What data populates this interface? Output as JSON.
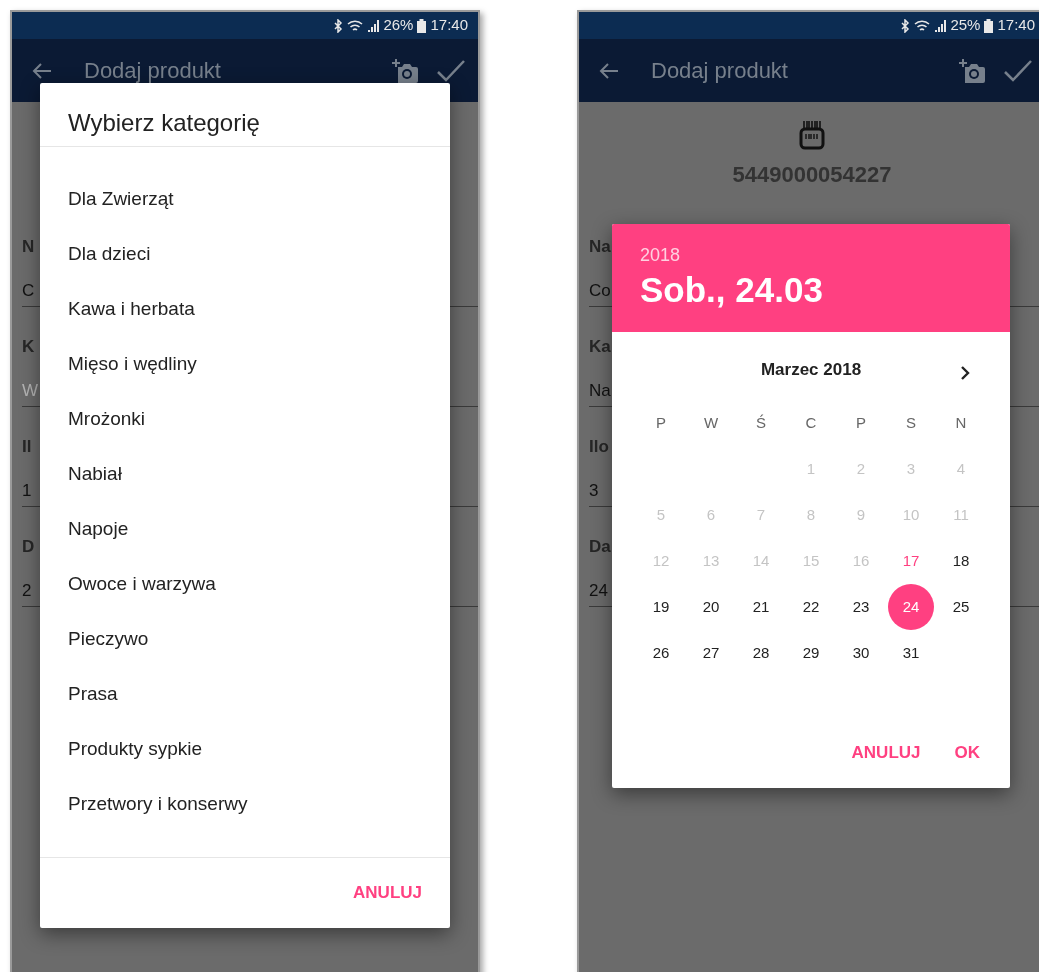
{
  "phones": [
    {
      "status_bar": {
        "battery": "26%",
        "time": "17:40"
      },
      "app_bar": {
        "title": "Dodaj produkt"
      },
      "fields": [
        {
          "label": "N",
          "value": "C"
        },
        {
          "label": "K",
          "placeholder": "W"
        },
        {
          "label": "Il",
          "value": "1"
        },
        {
          "label": "D",
          "value": "2"
        }
      ],
      "dialog": {
        "kind": "category_list",
        "title": "Wybierz kategorię",
        "items": [
          "Dla Zwierząt",
          "Dla dzieci",
          "Kawa i herbata",
          "Mięso i wędliny",
          "Mrożonki",
          "Nabiał",
          "Napoje",
          "Owoce i warzywa",
          "Pieczywo",
          "Prasa",
          "Produkty sypkie",
          "Przetwory i konserwy"
        ],
        "buttons": [
          "ANULUJ"
        ]
      }
    },
    {
      "status_bar": {
        "battery": "25%",
        "time": "17:40"
      },
      "app_bar": {
        "title": "Dodaj produkt"
      },
      "barcode": "5449000054227",
      "fields": [
        {
          "label": "Na",
          "value": "Co"
        },
        {
          "label": "Ka",
          "value": "Na"
        },
        {
          "label": "Ilo",
          "value": "3"
        },
        {
          "label": "Da",
          "value": "24"
        }
      ],
      "dialog": {
        "kind": "date_picker",
        "year": "2018",
        "date": "Sob., 24.03",
        "month": "Marzec 2018",
        "weekdays": [
          "P",
          "W",
          "Ś",
          "C",
          "P",
          "S",
          "N"
        ],
        "weeks": [
          [
            {
              "day": "1",
              "disabled": true,
              "today": false,
              "selected": false
            },
            {
              "day": "2",
              "disabled": true,
              "today": false,
              "selected": false
            },
            {
              "day": "3",
              "disabled": true,
              "today": false,
              "selected": false
            },
            {
              "day": "4",
              "disabled": true,
              "today": false,
              "selected": false
            }
          ],
          [
            {
              "day": "5",
              "disabled": true,
              "today": false,
              "selected": false
            },
            {
              "day": "6",
              "disabled": true,
              "today": false,
              "selected": false
            },
            {
              "day": "7",
              "disabled": true,
              "today": false,
              "selected": false
            },
            {
              "day": "8",
              "disabled": true,
              "today": false,
              "selected": false
            },
            {
              "day": "9",
              "disabled": true,
              "today": false,
              "selected": false
            },
            {
              "day": "10",
              "disabled": true,
              "today": false,
              "selected": false
            },
            {
              "day": "11",
              "disabled": true,
              "today": false,
              "selected": false
            }
          ],
          [
            {
              "day": "12",
              "disabled": true,
              "today": false,
              "selected": false
            },
            {
              "day": "13",
              "disabled": true,
              "today": false,
              "selected": false
            },
            {
              "day": "14",
              "disabled": true,
              "today": false,
              "selected": false
            },
            {
              "day": "15",
              "disabled": true,
              "today": false,
              "selected": false
            },
            {
              "day": "16",
              "disabled": true,
              "today": false,
              "selected": false
            },
            {
              "day": "17",
              "disabled": false,
              "today": true,
              "selected": false
            },
            {
              "day": "18",
              "disabled": false,
              "today": false,
              "selected": false
            }
          ],
          [
            {
              "day": "19",
              "disabled": false,
              "today": false,
              "selected": false
            },
            {
              "day": "20",
              "disabled": false,
              "today": false,
              "selected": false
            },
            {
              "day": "21",
              "disabled": false,
              "today": false,
              "selected": false
            },
            {
              "day": "22",
              "disabled": false,
              "today": false,
              "selected": false
            },
            {
              "day": "23",
              "disabled": false,
              "today": false,
              "selected": false
            },
            {
              "day": "24",
              "disabled": false,
              "today": false,
              "selected": true
            },
            {
              "day": "25",
              "disabled": false,
              "today": false,
              "selected": false
            }
          ],
          [
            {
              "day": "26",
              "disabled": false,
              "today": false,
              "selected": false
            },
            {
              "day": "27",
              "disabled": false,
              "today": false,
              "selected": false
            },
            {
              "day": "28",
              "disabled": false,
              "today": false,
              "selected": false
            },
            {
              "day": "29",
              "disabled": false,
              "today": false,
              "selected": false
            },
            {
              "day": "30",
              "disabled": false,
              "today": false,
              "selected": false
            },
            {
              "day": "31",
              "disabled": false,
              "today": false,
              "selected": false
            }
          ]
        ],
        "buttons": [
          "ANULUJ",
          "OK"
        ]
      }
    }
  ]
}
